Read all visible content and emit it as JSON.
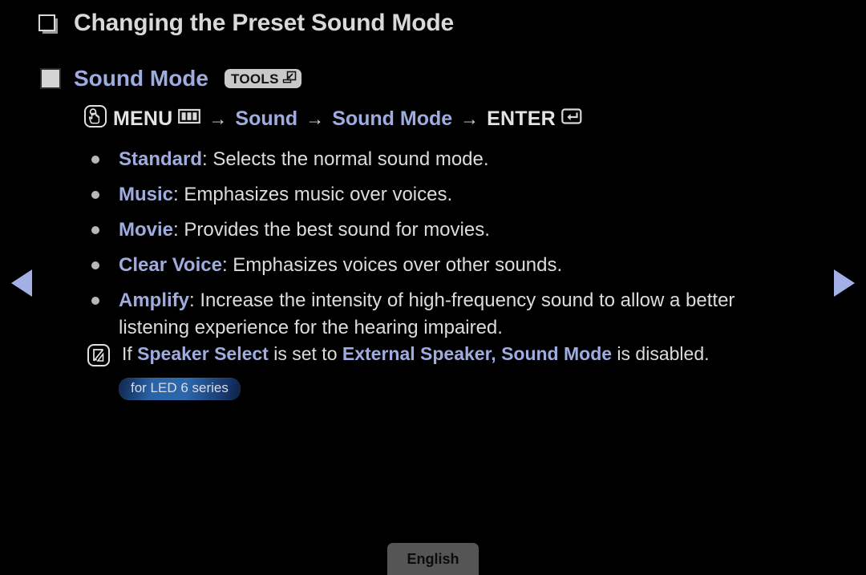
{
  "page": {
    "title": "Changing the Preset Sound Mode",
    "title_bullet_icon": "stacked-square-icon",
    "section": {
      "heading": "Sound Mode",
      "heading_bullet_icon": "filled-square-icon",
      "tools_badge": {
        "label": "TOOLS",
        "icon": "tools-arrow-icon"
      }
    },
    "menu_path": {
      "touch_icon": "touch-hand-icon",
      "menu_label": "MENU",
      "menu_icon": "menu-bars-icon",
      "arrow": "→",
      "step_sound": "Sound",
      "step_sound_mode": "Sound Mode",
      "enter_label": "ENTER",
      "enter_icon": "enter-key-icon"
    },
    "options": [
      {
        "name": "Standard",
        "description": ": Selects the normal sound mode."
      },
      {
        "name": "Music",
        "description": ": Emphasizes music over voices."
      },
      {
        "name": "Movie",
        "description": ": Provides the best sound for movies."
      },
      {
        "name": "Clear Voice",
        "description": ": Emphasizes voices over other sounds."
      },
      {
        "name": "Amplify",
        "description": ": Increase the intensity of high-frequency sound to allow a better listening experience for the hearing impaired."
      }
    ],
    "note": {
      "icon": "note-n-icon",
      "prefix": "If ",
      "term1": "Speaker Select",
      "middle": " is set to ",
      "term2": "External Speaker, Sound Mode",
      "suffix": " is disabled."
    },
    "series_badge": "for LED 6 series",
    "nav": {
      "prev_icon": "nav-previous-arrow-icon",
      "next_icon": "nav-next-arrow-icon"
    },
    "language_button": "English"
  },
  "colors": {
    "background": "#000000",
    "accent_blue": "#9facdf",
    "body_text": "#dcdcdc",
    "badge_gray": "#c9c9c9",
    "series_badge_blue": "#2a63a8",
    "lang_button_gray": "#555555"
  }
}
